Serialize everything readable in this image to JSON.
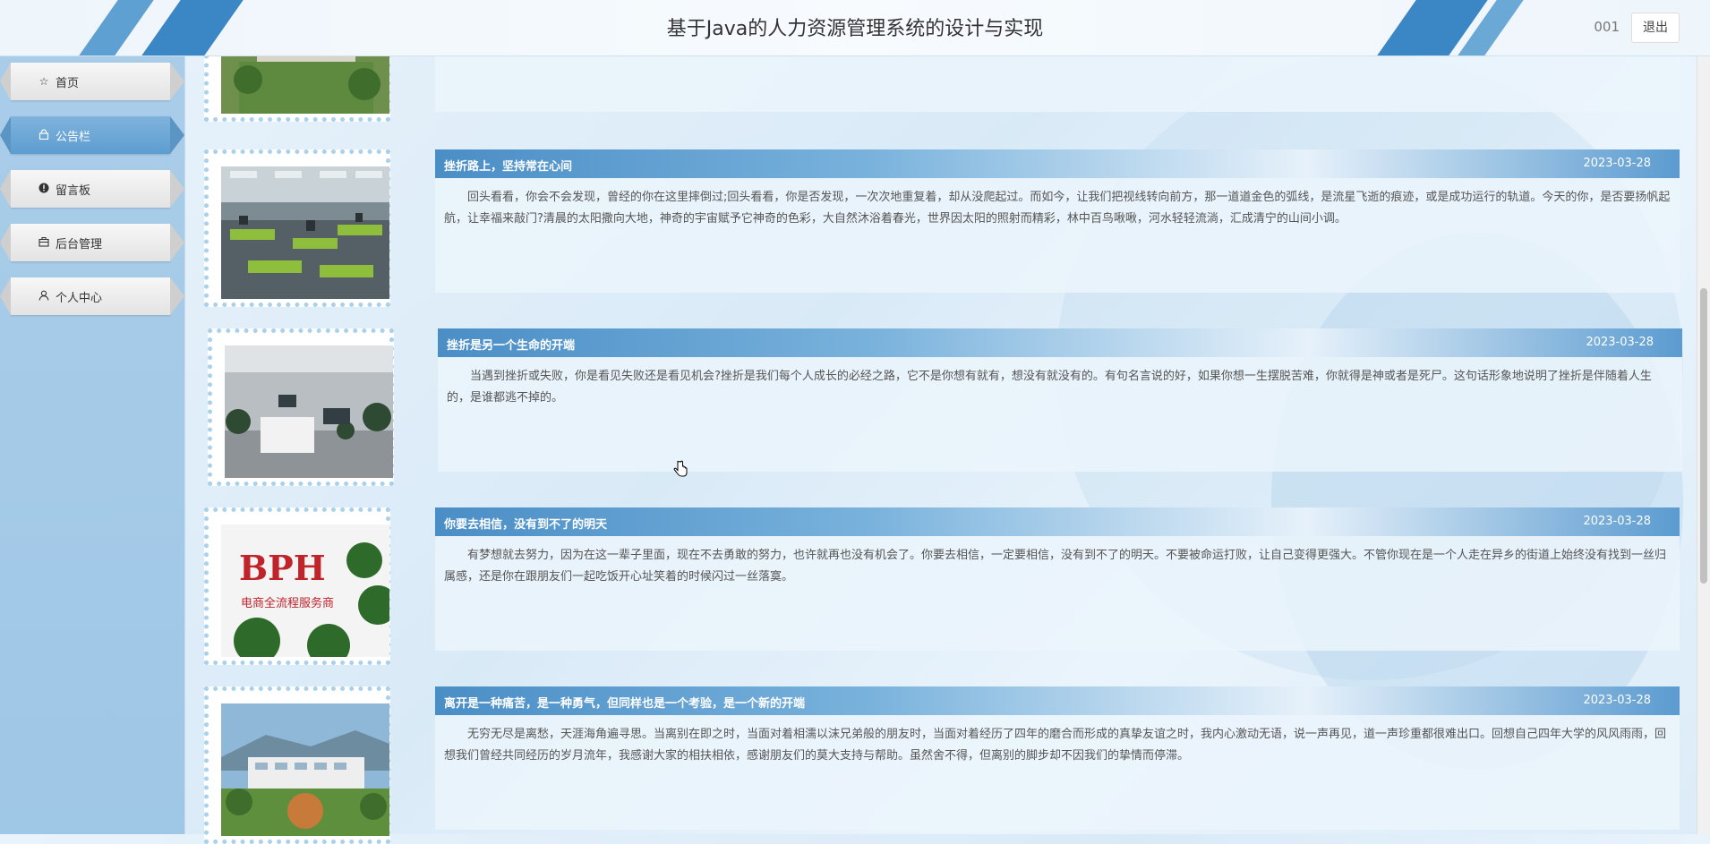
{
  "header": {
    "title": "基于Java的人力资源管理系统的设计与实现",
    "user": "001",
    "logout_label": "退出"
  },
  "sidebar": {
    "items": [
      {
        "label": "首页",
        "icon": "star-icon",
        "active": false
      },
      {
        "label": "公告栏",
        "icon": "lock-icon",
        "active": true
      },
      {
        "label": "留言板",
        "icon": "alert-icon",
        "active": false
      },
      {
        "label": "后台管理",
        "icon": "briefcase-icon",
        "active": false
      },
      {
        "label": "个人中心",
        "icon": "user-icon",
        "active": false
      }
    ]
  },
  "notices": [
    {
      "title": "",
      "date": "",
      "content": ""
    },
    {
      "title": "挫折路上，坚持常在心间",
      "date": "2023-03-28",
      "content": "回头看看，你会不会发现，曾经的你在这里摔倒过;回头看看，你是否发现，一次次地重复着，却从没爬起过。而如今，让我们把视线转向前方，那一道道金色的弧线，是流星飞逝的痕迹，或是成功运行的轨道。今天的你，是否要扬帆起航，让幸福来敲门?清晨的太阳撒向大地，神奇的宇宙赋予它神奇的色彩，大自然沐浴着春光，世界因太阳的照射而精彩，林中百鸟啾啾，河水轻轻流淌，汇成清宁的山间小调。"
    },
    {
      "title": "挫折是另一个生命的开端",
      "date": "2023-03-28",
      "content": "当遇到挫折或失败，你是看见失败还是看见机会?挫折是我们每个人成长的必经之路，它不是你想有就有，想没有就没有的。有句名言说的好，如果你想一生摆脱苦难，你就得是神或者是死尸。这句话形象地说明了挫折是伴随着人生的，是谁都逃不掉的。"
    },
    {
      "title": "你要去相信，没有到不了的明天",
      "date": "2023-03-28",
      "content": "有梦想就去努力，因为在这一辈子里面，现在不去勇敢的努力，也许就再也没有机会了。你要去相信，一定要相信，没有到不了的明天。不要被命运打败，让自己变得更强大。不管你现在是一个人走在异乡的街道上始终没有找到一丝归属感，还是你在跟朋友们一起吃饭开心址笑着的时候闪过一丝落寞。"
    },
    {
      "title": "离开是一种痛苦，是一种勇气，但同样也是一个考验，是一个新的开端",
      "date": "2023-03-28",
      "content": "无穷无尽是离愁，天涯海角遍寻思。当离别在即之时，当面对着相濡以沫兄弟般的朋友时，当面对着经历了四年的磨合而形成的真挚友谊之时，我内心激动无语，说一声再见，道一声珍重都很难出口。回想自己四年大学的风风雨雨，回想我们曾经共同经历的岁月流年，我感谢大家的相扶相依，感谢朋友们的莫大支持与帮助。虽然舍不得，但离别的脚步却不因我们的挚情而停滞。"
    }
  ],
  "thumbs": {
    "sign_text_main": "BPH",
    "sign_text_small": "电商全流程服务商"
  }
}
